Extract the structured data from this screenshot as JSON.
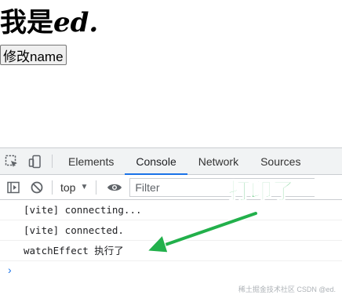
{
  "page": {
    "heading_prefix": "我是",
    "heading_em": "ed.",
    "modify_button": "修改name"
  },
  "devtools": {
    "tabs": [
      {
        "label": "Elements"
      },
      {
        "label": "Console",
        "active": true
      },
      {
        "label": "Network"
      },
      {
        "label": "Sources"
      }
    ],
    "toolbar": {
      "context": "top",
      "filter_placeholder": "Filter"
    },
    "console": {
      "messages": [
        "[vite] connecting...",
        "[vite] connected.",
        "watchEffect 执行了"
      ],
      "prompt_symbol": "›"
    },
    "accent_color": "#1a73e8"
  },
  "annotation": {
    "label": "打印了",
    "color": "#22b04b"
  },
  "watermark": "稀土掘金技术社区 CSDN @ed."
}
